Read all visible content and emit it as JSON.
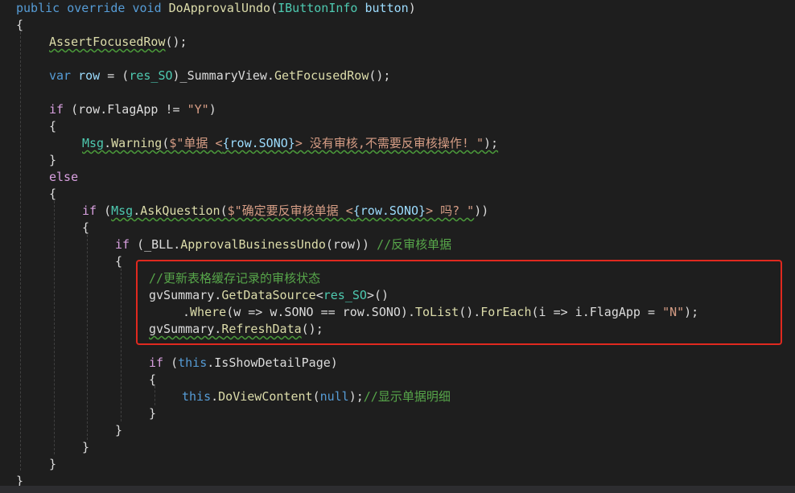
{
  "colors": {
    "background": "#1e1e1e",
    "keyword": "#569cd6",
    "type": "#4ec9b0",
    "method": "#dcdcaa",
    "string": "#d69d85",
    "comment": "#57a64a",
    "highlight_box": "#e0291f"
  },
  "code": {
    "l1": {
      "kw": "public override void",
      "method": "DoApprovalUndo",
      "params_open": "(",
      "ptype": "IButtonInfo",
      "pname": "button",
      "params_close": ")"
    },
    "l2": "{",
    "l3": {
      "method": "AssertFocusedRow",
      "rest": "();"
    },
    "l5": {
      "kw": "var",
      "var": "row",
      "eq": " = (",
      "type": "res_SO",
      "mid": ")_SummaryView.",
      "method": "GetFocusedRow",
      "rest": "();"
    },
    "l7": {
      "kw": "if",
      "cond_a": " (row.FlagApp != ",
      "str": "\"Y\"",
      "cond_b": ")"
    },
    "l8": "{",
    "l9": {
      "type": "Msg",
      "dot": ".",
      "method": "Warning",
      "open": "(",
      "str1": "$\"单据 <",
      "interp": "{row.SONO}",
      "str2": "> 没有审核,不需要反审核操作! \"",
      "close": ");"
    },
    "l10": "}",
    "l11": {
      "kw": "else"
    },
    "l12": "{",
    "l13": {
      "kw": "if",
      "a": " (",
      "type": "Msg",
      "dot": ".",
      "method": "AskQuestion",
      "open": "(",
      "str1": "$\"确定要反审核单据 <",
      "interp": "{row.SONO}",
      "str2": "> 吗? \"",
      "close": "))"
    },
    "l14": "{",
    "l15": {
      "kw": "if",
      "a": " (_BLL.",
      "method": "ApprovalBusinessUndo",
      "b": "(row)) ",
      "comment": "//反审核单据"
    },
    "l16": "{",
    "l17": {
      "comment": "//更新表格缓存记录的审核状态"
    },
    "l18": {
      "obj": "gvSummary.",
      "method": "GetDataSource",
      "lt": "<",
      "type": "res_SO",
      "rest": ">()"
    },
    "l19": {
      "dot": ".",
      "where": "Where",
      "a": "(w => w.SONO == row.SONO).",
      "tolist": "ToList",
      "b": "().",
      "foreach": "ForEach",
      "c": "(i => i.FlagApp = ",
      "str": "\"N\"",
      "d": ");"
    },
    "l20": {
      "obj": "gvSummary.",
      "method": "RefreshData",
      "rest": "();"
    },
    "l22": {
      "kw": "if",
      "a": " (",
      "kw2": "this",
      "b": ".IsShowDetailPage)"
    },
    "l23": "{",
    "l24": {
      "kw": "this",
      "dot": ".",
      "method": "DoViewContent",
      "open": "(",
      "null": "null",
      "close": ");",
      "comment": "//显示单据明细"
    },
    "l25": "}",
    "l26": "}",
    "l27": "}",
    "l28": "}",
    "l29": "}"
  }
}
